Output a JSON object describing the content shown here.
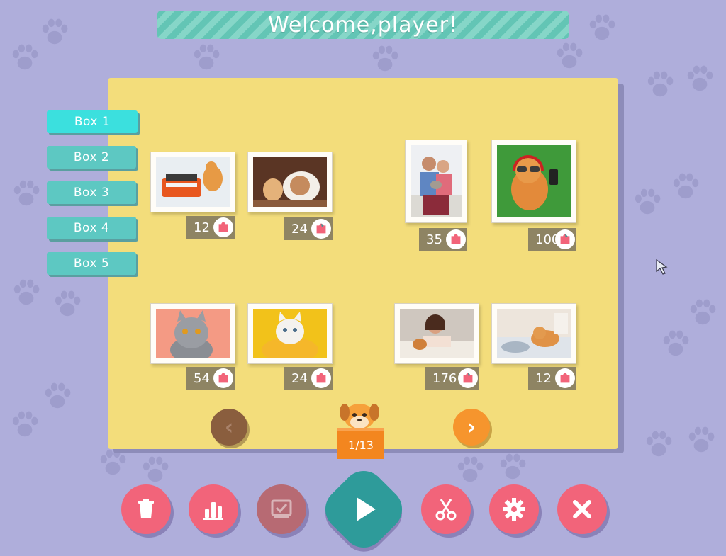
{
  "header": {
    "title": "Welcome,player!"
  },
  "boxes": [
    {
      "label": "Box 1",
      "active": true
    },
    {
      "label": "Box 2",
      "active": false
    },
    {
      "label": "Box 3",
      "active": false
    },
    {
      "label": "Box 4",
      "active": false
    },
    {
      "label": "Box 5",
      "active": false
    }
  ],
  "puzzles": [
    {
      "subject": "kitten-with-typewriter",
      "pieces": "12"
    },
    {
      "subject": "dog-and-kitten",
      "pieces": "24"
    },
    {
      "subject": "couple-with-cat",
      "pieces": "35"
    },
    {
      "subject": "cat-with-headphones",
      "pieces": "100"
    },
    {
      "subject": "grey-cat",
      "pieces": "54"
    },
    {
      "subject": "cat-in-yellow-blanket",
      "pieces": "24"
    },
    {
      "subject": "woman-with-kitten",
      "pieces": "176"
    },
    {
      "subject": "sleeping-ginger-cat",
      "pieces": "12"
    }
  ],
  "pager": {
    "page": "1/13"
  },
  "toolbar": [
    {
      "icon": "trash-icon",
      "state": "enabled"
    },
    {
      "icon": "stats-icon",
      "state": "enabled"
    },
    {
      "icon": "check-box-icon",
      "state": "disabled"
    },
    {
      "icon": "play-icon",
      "state": "enabled"
    },
    {
      "icon": "scissors-icon",
      "state": "enabled"
    },
    {
      "icon": "gear-icon",
      "state": "enabled"
    },
    {
      "icon": "close-icon",
      "state": "enabled"
    }
  ],
  "colors": {
    "background": "#afaedb",
    "board": "#f3dd7b",
    "tab": "#5dc8c2",
    "tab_active": "#3be0de",
    "button": "#f2647a",
    "play": "#2e9b9a",
    "badge": "#8e8463",
    "page_box": "#f3861f"
  }
}
